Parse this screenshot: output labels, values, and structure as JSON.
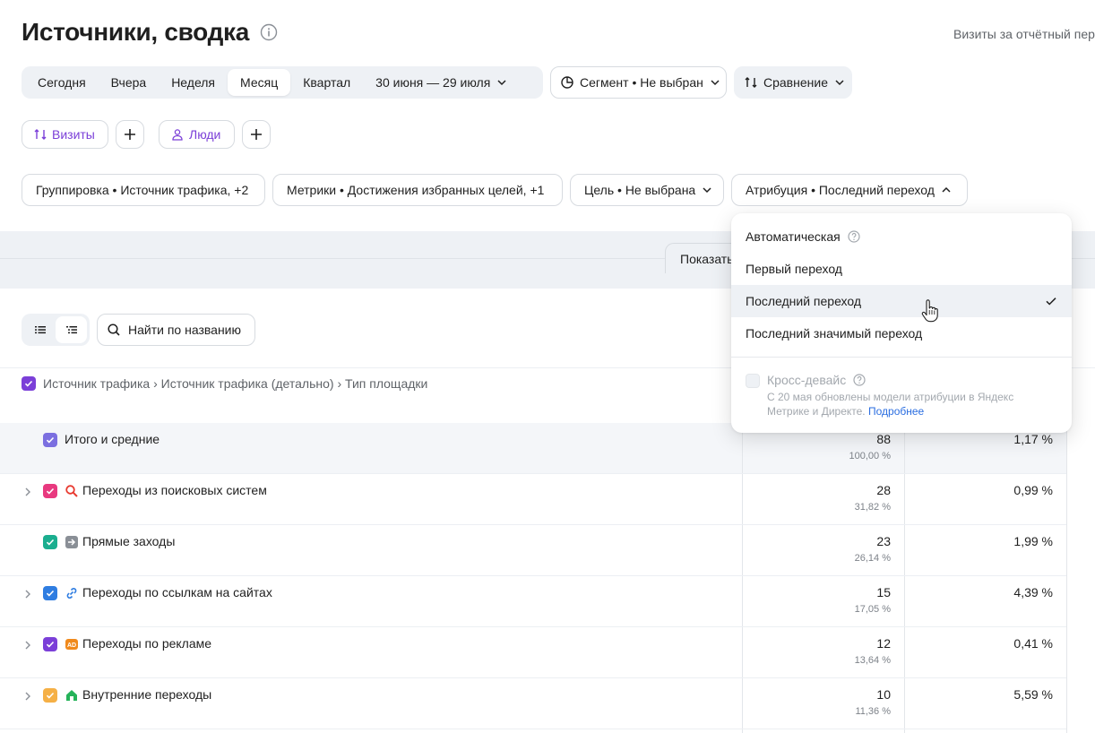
{
  "page": {
    "title": "Источники, сводка",
    "top_right_note": "Визиты за отчётный пер"
  },
  "period": {
    "tabs": [
      "Сегодня",
      "Вчера",
      "Неделя",
      "Месяц",
      "Квартал"
    ],
    "active_tab": "Месяц",
    "date_range": "30 июня — 29 июля"
  },
  "segment_label": "Сегмент • Не выбран",
  "compare_label": "Сравнение",
  "chips": {
    "visits": "Визиты",
    "people": "Люди"
  },
  "filters": {
    "grouping": "Группировка • Источник трафика, +2",
    "metrics": "Метрики • Достижения избранных целей, +1",
    "goal": "Цель • Не выбрана",
    "attribution": "Атрибуция • Последний переход"
  },
  "show_button": "Показать",
  "search": {
    "placeholder": "Найти по названию"
  },
  "table": {
    "group_header": "Источник трафика › Источник трафика (детально) › Тип площадки",
    "total": {
      "label": "Итого и средние",
      "value": "88",
      "share": "100,00 %",
      "rate": "1,17 %"
    },
    "rows": [
      {
        "label": "Переходы из поисковых систем",
        "value": "28",
        "share": "31,82 %",
        "rate": "0,99 %",
        "checkbox_color": "#e8397f",
        "icon": "search-icon",
        "expandable": true
      },
      {
        "label": "Прямые заходы",
        "value": "23",
        "share": "26,14 %",
        "rate": "1,99 %",
        "checkbox_color": "#1bae8f",
        "icon": "direct-arrow-icon",
        "expandable": false
      },
      {
        "label": "Переходы по ссылкам на сайтах",
        "value": "15",
        "share": "17,05 %",
        "rate": "4,39 %",
        "checkbox_color": "#2f7de1",
        "icon": "link-icon",
        "expandable": true
      },
      {
        "label": "Переходы по рекламе",
        "value": "12",
        "share": "13,64 %",
        "rate": "0,41 %",
        "checkbox_color": "#7b3fd8",
        "icon": "ad-icon",
        "expandable": true
      },
      {
        "label": "Внутренние переходы",
        "value": "10",
        "share": "11,36 %",
        "rate": "5,59 %",
        "checkbox_color": "#f5b046",
        "icon": "home-icon",
        "expandable": true
      }
    ]
  },
  "attribution_menu": {
    "items": [
      "Автоматическая",
      "Первый переход",
      "Последний переход",
      "Последний значимый переход"
    ],
    "selected": "Последний переход",
    "cross_device_label": "Кросс-девайс",
    "cross_device_note": "С 20 мая обновлены модели атрибуции в Яндекс Метрике и Директе.",
    "cross_device_link": "Подробнее"
  },
  "colors": {
    "accent_purple": "#7b3fd8",
    "link_blue": "#2a6de0",
    "grey_bg": "#eef1f5"
  }
}
